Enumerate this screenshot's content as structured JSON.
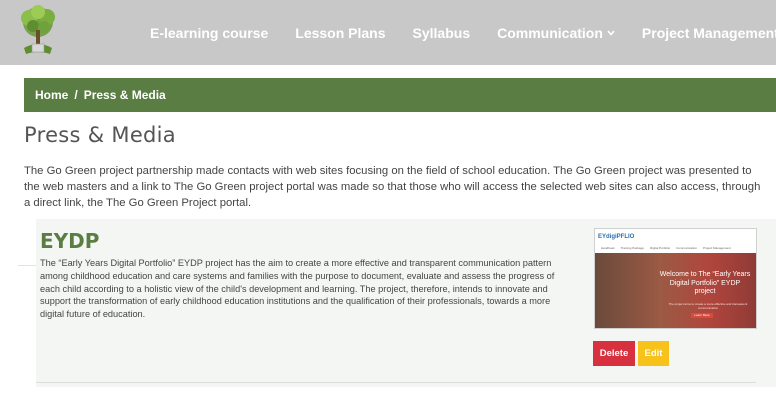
{
  "header": {
    "logo_icon": "tree-logo-icon",
    "nav": [
      {
        "label": "E-learning course",
        "has_dropdown": false
      },
      {
        "label": "Lesson Plans",
        "has_dropdown": false
      },
      {
        "label": "Syllabus",
        "has_dropdown": false
      },
      {
        "label": "Communication",
        "has_dropdown": true
      },
      {
        "label": "Project Management",
        "has_dropdown": true
      }
    ]
  },
  "breadcrumb": {
    "home": "Home",
    "separator": "/",
    "current": "Press & Media"
  },
  "page": {
    "title": "Press & Media",
    "intro": "The Go Green project partnership made contacts with web sites focusing on the field of school education. The Go Green project was presented to the web masters and a link to The Go Green project portal was made so that those who will access the selected web sites can also access, through a direct link, the The Go Green Project portal."
  },
  "entry": {
    "title": "EYDP",
    "body": "The “Early Years Digital Portfolio” EYDP project has the aim to create a more effective and transparent communication pattern among childhood education and care systems and families with the purpose to document, evaluate and assess the progress of each child according to a holistic view of the child's development and learning. The project, therefore, intends to innovate and support the transformation of early childhood education institutions and the qualification of their professionals, towards a more digital future of education.",
    "thumbnail": {
      "logo": "EYdigiPFLIO",
      "menu": [
        "Handbook",
        "Training Package",
        "Digital Portfolio",
        "Communication",
        "Project Management"
      ],
      "hero_title": "Welcome to The “Early Years Digital Portfolio” EYDP project",
      "hero_sub": "The project aims to create a more effective and transparent communication",
      "hero_button": "Learn More"
    },
    "delete_label": "Delete",
    "edit_label": "Edit"
  },
  "colors": {
    "header_bg": "#c8c8c8",
    "brand_green": "#5a7d44",
    "delete_red": "#d7303f",
    "edit_yellow": "#f7c21a"
  }
}
